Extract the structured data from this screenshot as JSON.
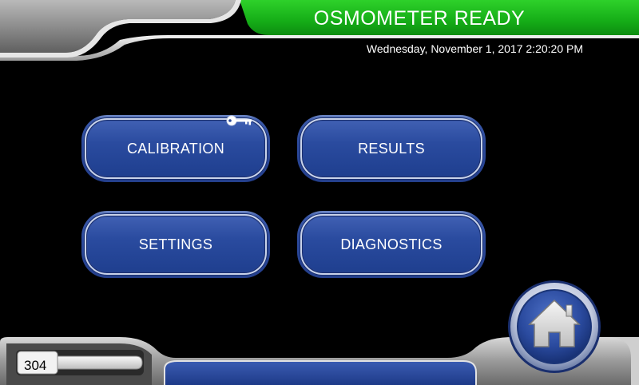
{
  "header": {
    "status_title": "OSMOMETER READY",
    "datetime": "Wednesday, November 1, 2017 2:20:20 PM"
  },
  "menu": {
    "calibration_label": "CALIBRATION",
    "results_label": "RESULTS",
    "settings_label": "SETTINGS",
    "diagnostics_label": "DIAGNOSTICS"
  },
  "icons": {
    "calibration_badge": "key-icon",
    "home": "home-icon"
  },
  "footer": {
    "counter_value": "304"
  },
  "colors": {
    "status_green": "#17b31b",
    "button_blue": "#2c4a9c",
    "panel_grey": "#8a8a8a",
    "background": "#000000"
  }
}
